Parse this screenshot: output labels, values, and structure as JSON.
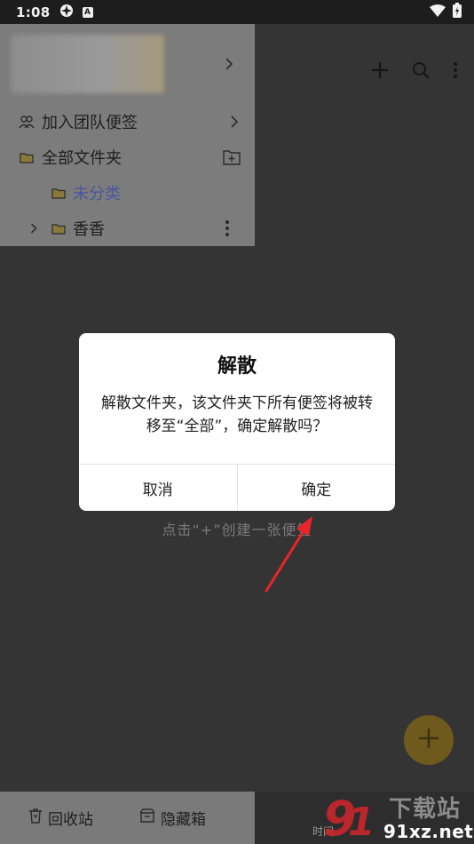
{
  "status_bar": {
    "time": "1:08",
    "app_badge": "A"
  },
  "toolbar": {
    "icons": [
      "plus-icon",
      "search-icon",
      "more-vert-icon"
    ]
  },
  "drawer": {
    "items": [
      {
        "label": "加入团队便签",
        "icon": "team-icon",
        "trail": "chevron-right-icon"
      },
      {
        "label": "全部文件夹",
        "icon": "folder-icon",
        "trail": "add-folder-icon"
      },
      {
        "label": "未分类",
        "icon": "folder-icon",
        "selected": true
      },
      {
        "label": "香香",
        "icon": "folder-icon",
        "trail": "more-vert-icon"
      }
    ]
  },
  "main": {
    "empty_hint": "点击“+”创建一张便签"
  },
  "bottom_nav": {
    "recycle_label": "回收站",
    "hidden_label": "隐藏箱",
    "extra_label": "时间"
  },
  "dialog": {
    "title": "解散",
    "message": "解散文件夹，该文件夹下所有便签将被转移至“全部”，确定解散吗？",
    "cancel_label": "取消",
    "confirm_label": "确定"
  },
  "watermark": {
    "text": "91xz.net",
    "sub": "下载站"
  },
  "colors": {
    "accent_selected": "#4a56a0",
    "folder_icon": "#8a7a3a",
    "fab": "#6e5a1c",
    "arrow": "#e8262a"
  }
}
